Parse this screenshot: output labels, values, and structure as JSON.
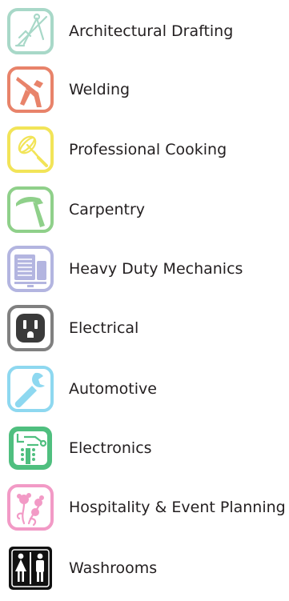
{
  "legend": {
    "items": [
      {
        "label": "Architectural Drafting",
        "icon": "drafting-compass-icon",
        "color": "#a8d8c8"
      },
      {
        "label": "Welding",
        "icon": "welding-torch-icon",
        "color": "#e8836a"
      },
      {
        "label": "Professional Cooking",
        "icon": "whisk-icon",
        "color": "#f2e458"
      },
      {
        "label": "Carpentry",
        "icon": "hammer-icon",
        "color": "#8fd08a"
      },
      {
        "label": "Heavy Duty Mechanics",
        "icon": "truck-icon",
        "color": "#b3b5e0"
      },
      {
        "label": "Electrical",
        "icon": "electrical-outlet-icon",
        "color": "#808080"
      },
      {
        "label": "Automotive",
        "icon": "wrench-icon",
        "color": "#8ed8f0"
      },
      {
        "label": "Electronics",
        "icon": "circuit-board-icon",
        "color": "#4fbf7f"
      },
      {
        "label": "Hospitality & Event Planning",
        "icon": "flowers-icon",
        "color": "#f29ac6"
      },
      {
        "label": "Washrooms",
        "icon": "washroom-icon",
        "color": "#111111"
      }
    ]
  }
}
